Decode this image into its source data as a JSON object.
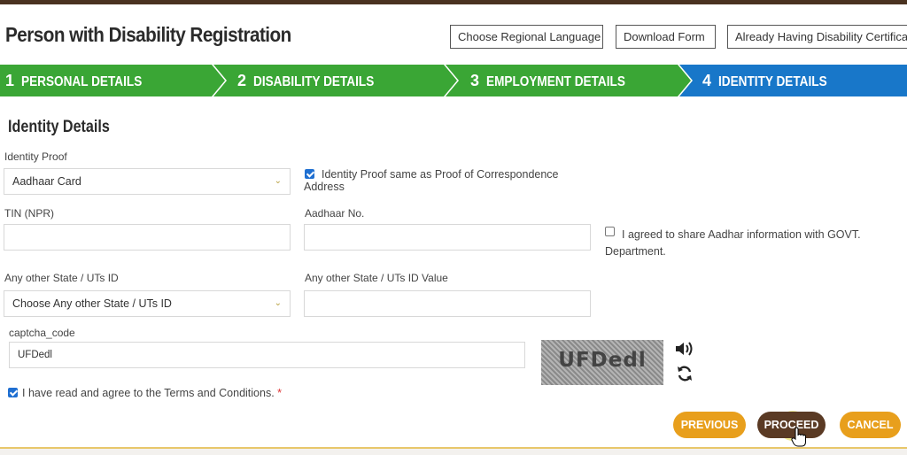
{
  "page": {
    "title": "Person with Disability Registration"
  },
  "header_buttons": {
    "language": "Choose Regional Language",
    "download": "Download Form",
    "certificate": "Already Having Disability Certifica"
  },
  "steps": [
    {
      "num": "1",
      "label": "PERSONAL DETAILS",
      "state": "done"
    },
    {
      "num": "2",
      "label": "DISABILITY DETAILS",
      "state": "done"
    },
    {
      "num": "3",
      "label": "EMPLOYMENT DETAILS",
      "state": "done"
    },
    {
      "num": "4",
      "label": "IDENTITY DETAILS",
      "state": "active"
    }
  ],
  "colors": {
    "step_done": "#3aa635",
    "step_active": "#1877c9",
    "button_orange": "#e89f1c",
    "button_brown": "#5a3a24",
    "checkbox_blue": "#1f6fd1"
  },
  "form": {
    "section_title": "Identity Details",
    "identity_proof": {
      "label": "Identity Proof",
      "value": "Aadhaar Card"
    },
    "same_as_correspondence": {
      "checked": true,
      "label": "Identity Proof same as Proof of Correspondence Address"
    },
    "tin": {
      "label": "TIN (NPR)",
      "value": ""
    },
    "aadhaar_no": {
      "label": "Aadhaar No.",
      "value": ""
    },
    "aadhaar_share": {
      "checked": false,
      "label": "I agreed to share Aadhar information with GOVT. Department."
    },
    "other_state_id": {
      "label": "Any other State / UTs ID",
      "value": "Choose Any other State / UTs ID"
    },
    "other_state_id_value": {
      "label": "Any other State / UTs ID Value",
      "value": ""
    },
    "captcha": {
      "label": "captcha_code",
      "value": "UFDedl",
      "image_text": "UFDedl"
    },
    "terms": {
      "checked": true,
      "label": "I have read and agree to the Terms and Conditions.",
      "required_mark": "*"
    }
  },
  "actions": {
    "previous": "PREVIOUS",
    "proceed": "PROCEED",
    "cancel": "CANCEL"
  }
}
